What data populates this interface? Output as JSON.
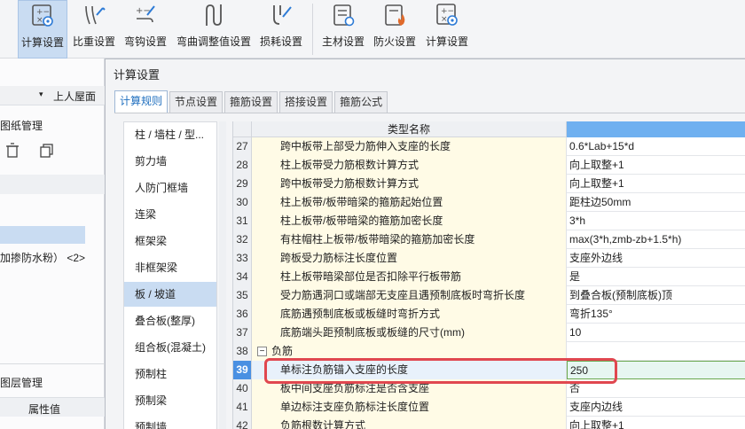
{
  "ribbon": {
    "items": [
      {
        "label": "计算设置",
        "icon": "calc-settings-icon"
      },
      {
        "label": "比重设置",
        "icon": "weight-settings-icon"
      },
      {
        "label": "弯钩设置",
        "icon": "hook-settings-icon"
      },
      {
        "label": "弯曲调整值设置",
        "icon": "bend-adjust-icon"
      },
      {
        "label": "损耗设置",
        "icon": "loss-settings-icon"
      },
      {
        "label": "主材设置",
        "icon": "main-material-icon"
      },
      {
        "label": "防火设置",
        "icon": "fire-settings-icon"
      },
      {
        "label": "计算设置",
        "icon": "calc-settings-icon"
      }
    ]
  },
  "left_panel": {
    "floor_select": "上人屋面",
    "drawing_mgmt": "图纸管理",
    "item_text": "加掺防水粉） <2>",
    "layer_mgmt": "图层管理",
    "prop_value": "属性值"
  },
  "dialog": {
    "title": "计算设置",
    "tabs": [
      "计算规则",
      "节点设置",
      "箍筋设置",
      "搭接设置",
      "箍筋公式"
    ],
    "active_tab": 0,
    "categories": [
      "柱 / 墙柱 / 型...",
      "剪力墙",
      "人防门框墙",
      "连梁",
      "框架梁",
      "非框架梁",
      "板 / 坡道",
      "叠合板(整厚)",
      "组合板(混凝土)",
      "预制柱",
      "预制梁",
      "预制墙"
    ],
    "active_category": 6,
    "grid": {
      "header_name": "类型名称",
      "rows": [
        {
          "num": "27",
          "name": "跨中板带上部受力筋伸入支座的长度",
          "value": "0.6*Lab+15*d"
        },
        {
          "num": "28",
          "name": "柱上板带受力筋根数计算方式",
          "value": "向上取整+1"
        },
        {
          "num": "29",
          "name": "跨中板带受力筋根数计算方式",
          "value": "向上取整+1"
        },
        {
          "num": "30",
          "name": "柱上板带/板带暗梁的箍筋起始位置",
          "value": "距柱边50mm"
        },
        {
          "num": "31",
          "name": "柱上板带/板带暗梁的箍筋加密长度",
          "value": "3*h"
        },
        {
          "num": "32",
          "name": "有柱帽柱上板带/板带暗梁的箍筋加密长度",
          "value": "max(3*h,zmb-zb+1.5*h)"
        },
        {
          "num": "33",
          "name": "跨板受力筋标注长度位置",
          "value": "支座外边线"
        },
        {
          "num": "34",
          "name": "柱上板带暗梁部位是否扣除平行板带筋",
          "value": "是"
        },
        {
          "num": "35",
          "name": "受力筋遇洞口或端部无支座且遇预制底板时弯折长度",
          "value": "到叠合板(预制底板)顶"
        },
        {
          "num": "36",
          "name": "底筋遇预制底板或板缝时弯折方式",
          "value": "弯折135°"
        },
        {
          "num": "37",
          "name": "底筋端头距预制底板或板缝的尺寸(mm)",
          "value": "10"
        },
        {
          "num": "38",
          "name": "负筋",
          "value": "",
          "group": true
        },
        {
          "num": "39",
          "name": "单标注负筋锚入支座的长度",
          "value": "250",
          "selected": true
        },
        {
          "num": "40",
          "name": "板中间支座负筋标注是否含支座",
          "value": "否"
        },
        {
          "num": "41",
          "name": "单边标注支座负筋标注长度位置",
          "value": "支座内边线"
        },
        {
          "num": "42",
          "name": "负筋根数计算方式",
          "value": "向上取整+1"
        }
      ]
    }
  }
}
